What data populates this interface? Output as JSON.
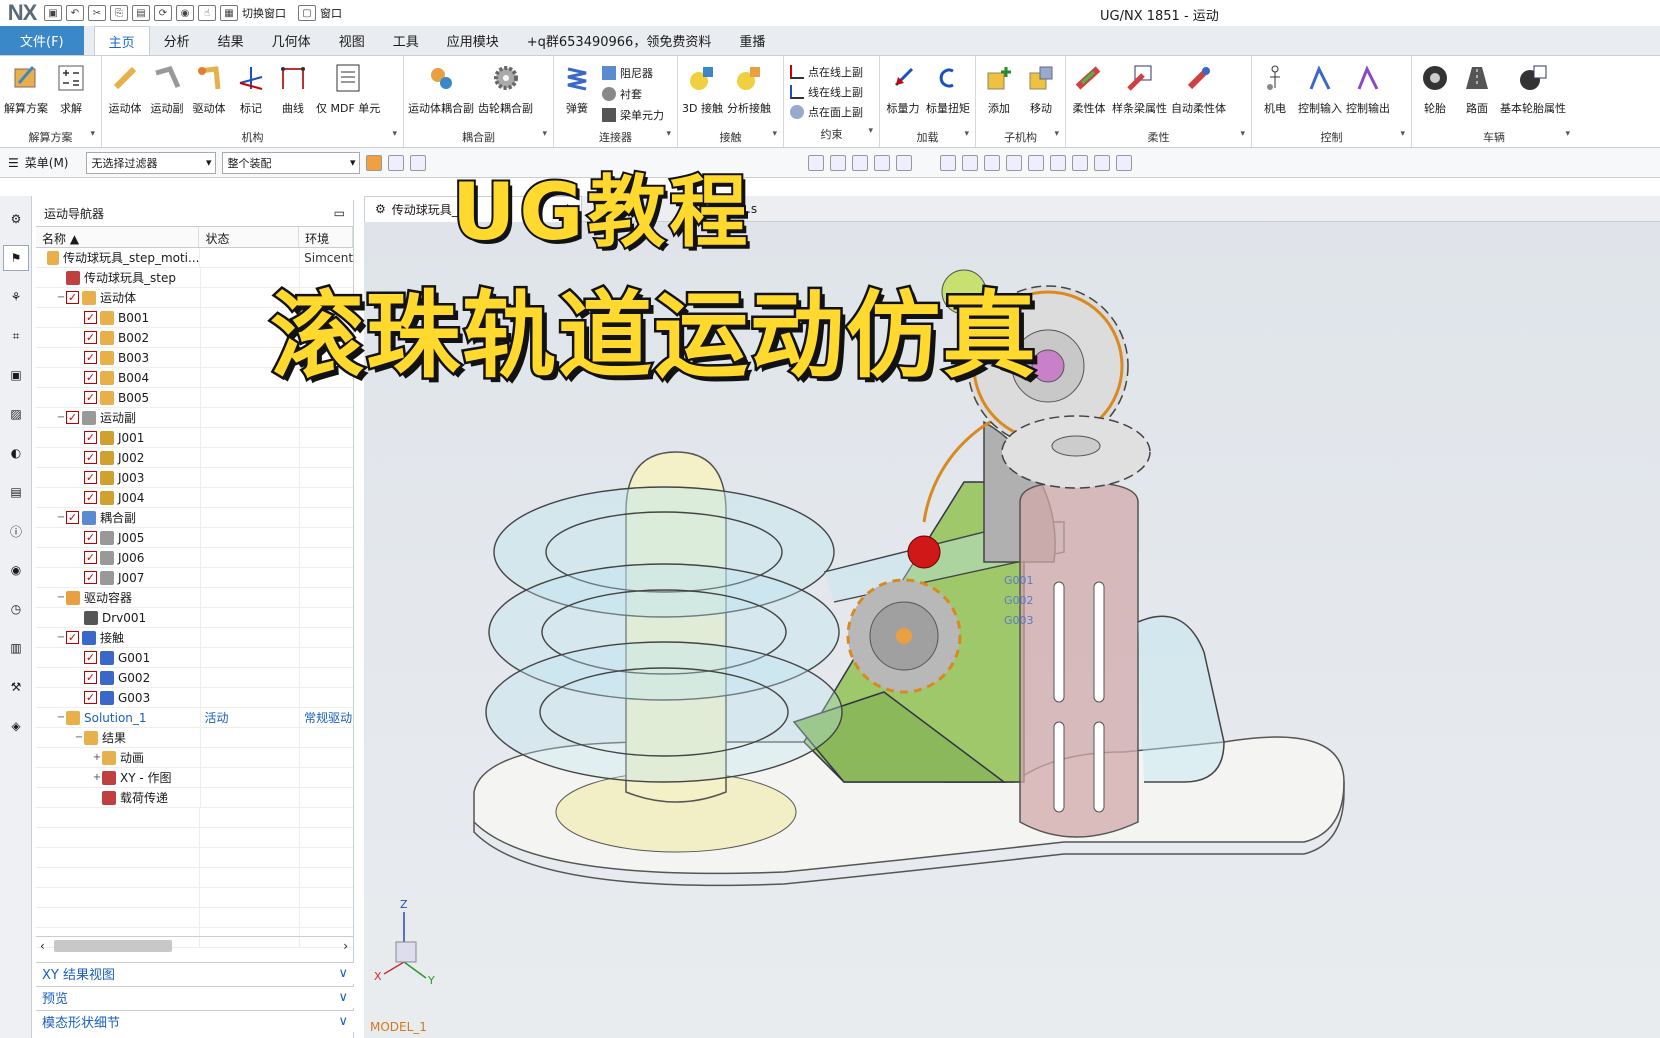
{
  "titlebar": {
    "logo": "NX",
    "switch_window": "切换窗口",
    "window": "窗口",
    "title": "UG/NX 1851 - 运动"
  },
  "menu": {
    "items": [
      "文件(F)",
      "主页",
      "分析",
      "结果",
      "几何体",
      "视图",
      "工具",
      "应用模块",
      "+q群653490966，领免费资料",
      "重播"
    ]
  },
  "ribbon": {
    "groups": [
      {
        "name": "解算方案",
        "buttons": [
          "解算方案",
          "求解"
        ]
      },
      {
        "name": "机构",
        "buttons": [
          "运动体",
          "运动副",
          "驱动体",
          "标记",
          "曲线",
          "仅 MDF 单元"
        ]
      },
      {
        "name": "耦合副",
        "buttons": [
          "运动体耦合副",
          "齿轮耦合副"
        ]
      },
      {
        "name": "连接器",
        "buttons": [
          "弹簧"
        ],
        "small": [
          "阻尼器",
          "衬套",
          "梁单元力"
        ]
      },
      {
        "name": "接触",
        "buttons": [
          "3D 接触",
          "分析接触"
        ]
      },
      {
        "name": "约束",
        "small": [
          "点在线上副",
          "线在线上副",
          "点在面上副"
        ]
      },
      {
        "name": "加载",
        "buttons": [
          "标量力",
          "标量扭矩"
        ]
      },
      {
        "name": "子机构",
        "buttons": [
          "添加",
          "移动"
        ]
      },
      {
        "name": "柔性",
        "buttons": [
          "柔性体",
          "样条梁属性",
          "自动柔性体"
        ]
      },
      {
        "name": "控制",
        "buttons": [
          "机电",
          "控制输入",
          "控制输出"
        ]
      },
      {
        "name": "车辆",
        "buttons": [
          "轮胎",
          "路面",
          "基本轮胎属性"
        ]
      }
    ]
  },
  "toolbar2": {
    "menu": "菜单(M)",
    "filter": "无选择过滤器",
    "assembly": "整个装配"
  },
  "navigator": {
    "title": "运动导航器",
    "columns": [
      "名称",
      "状态",
      "环境"
    ],
    "rows": [
      {
        "name": "传动球玩具_step_moti...",
        "state": "",
        "env": "Simcenter"
      },
      {
        "name": "传动球玩具_step",
        "state": "",
        "env": ""
      },
      {
        "name": "运动体",
        "state": "",
        "env": ""
      },
      {
        "name": "B001",
        "state": "",
        "env": ""
      },
      {
        "name": "B002",
        "state": "",
        "env": ""
      },
      {
        "name": "B003",
        "state": "",
        "env": ""
      },
      {
        "name": "B004",
        "state": "",
        "env": ""
      },
      {
        "name": "B005",
        "state": "",
        "env": ""
      },
      {
        "name": "运动副",
        "state": "",
        "env": ""
      },
      {
        "name": "J001",
        "state": "",
        "env": ""
      },
      {
        "name": "J002",
        "state": "",
        "env": ""
      },
      {
        "name": "J003",
        "state": "",
        "env": ""
      },
      {
        "name": "J004",
        "state": "",
        "env": ""
      },
      {
        "name": "耦合副",
        "state": "",
        "env": ""
      },
      {
        "name": "J005",
        "state": "",
        "env": ""
      },
      {
        "name": "J006",
        "state": "",
        "env": ""
      },
      {
        "name": "J007",
        "state": "",
        "env": ""
      },
      {
        "name": "驱动容器",
        "state": "",
        "env": ""
      },
      {
        "name": "Drv001",
        "state": "",
        "env": ""
      },
      {
        "name": "接触",
        "state": "",
        "env": ""
      },
      {
        "name": "G001",
        "state": "",
        "env": ""
      },
      {
        "name": "G002",
        "state": "",
        "env": ""
      },
      {
        "name": "G003",
        "state": "",
        "env": ""
      },
      {
        "name": "Solution_1",
        "state": "活动",
        "env": "常规驱动"
      },
      {
        "name": "结果",
        "state": "",
        "env": ""
      },
      {
        "name": "动画",
        "state": "",
        "env": ""
      },
      {
        "name": "XY - 作图",
        "state": "",
        "env": ""
      },
      {
        "name": "载荷传递",
        "state": "",
        "env": ""
      }
    ],
    "panels": [
      "XY 结果视图",
      "预览",
      "模态形状细节"
    ]
  },
  "viewport": {
    "tab1": "传动球玩具_",
    "tab1_suffix": "ort",
    "tab2": "n1.s",
    "model_label": "MODEL_1",
    "labels": [
      "G001",
      "G002",
      "G003"
    ]
  },
  "overlay": {
    "line1": "UG教程",
    "line2": "滚珠轨道运动仿真"
  }
}
